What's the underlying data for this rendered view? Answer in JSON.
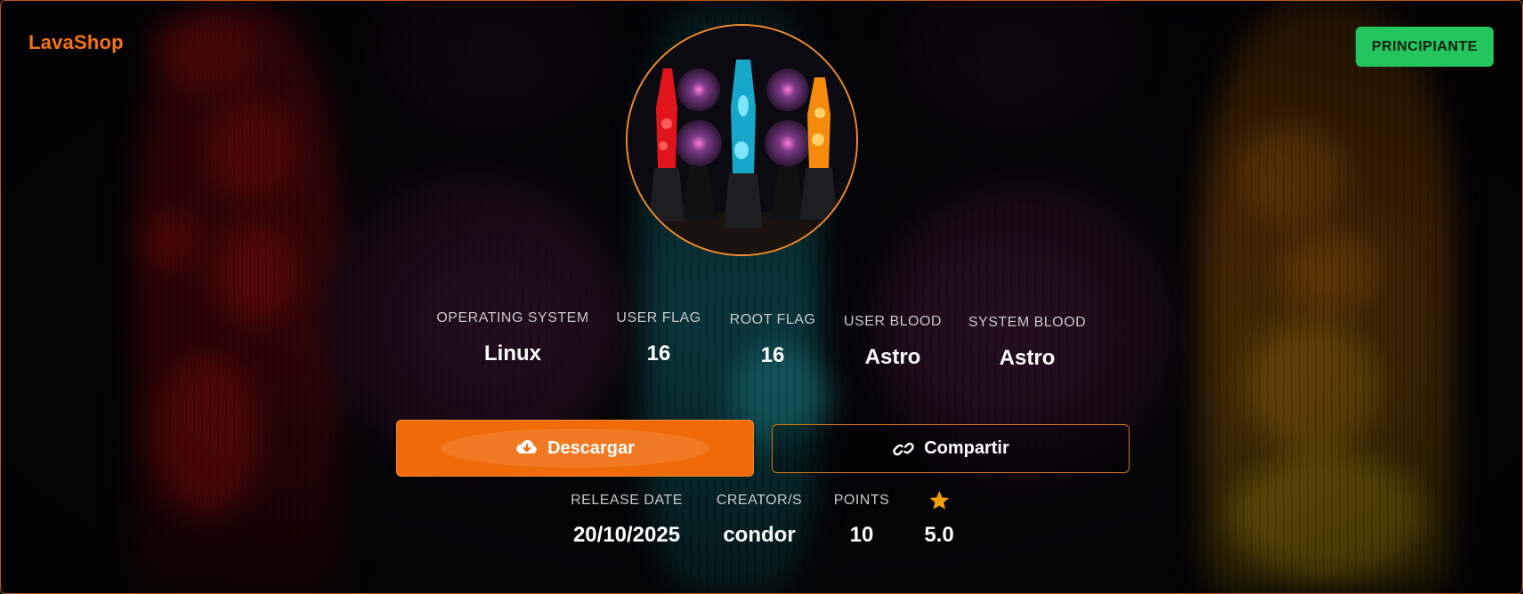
{
  "header": {
    "brand": "LavaShop",
    "level_badge": "PRINCIPIANTE"
  },
  "stats": [
    {
      "label": "OPERATING SYSTEM",
      "value": "Linux"
    },
    {
      "label": "USER FLAG",
      "value": "16"
    },
    {
      "label": "ROOT FLAG",
      "value": "16"
    },
    {
      "label": "USER BLOOD",
      "value": "Astro"
    },
    {
      "label": "SYSTEM BLOOD",
      "value": "Astro"
    }
  ],
  "actions": {
    "download_label": "Descargar",
    "download_icon": "cloud-download-icon",
    "share_label": "Compartir",
    "share_icon": "link-icon"
  },
  "meta": [
    {
      "label": "RELEASE DATE",
      "value": "20/10/2025"
    },
    {
      "label": "CREATOR/S",
      "value": "condor"
    },
    {
      "label": "POINTS",
      "value": "10"
    },
    {
      "label": "",
      "value": "5.0",
      "icon": "star-icon"
    }
  ],
  "colors": {
    "accent": "#f97316",
    "badge": "#22c55e",
    "star": "#f59e0b",
    "border": "#c2560e"
  }
}
